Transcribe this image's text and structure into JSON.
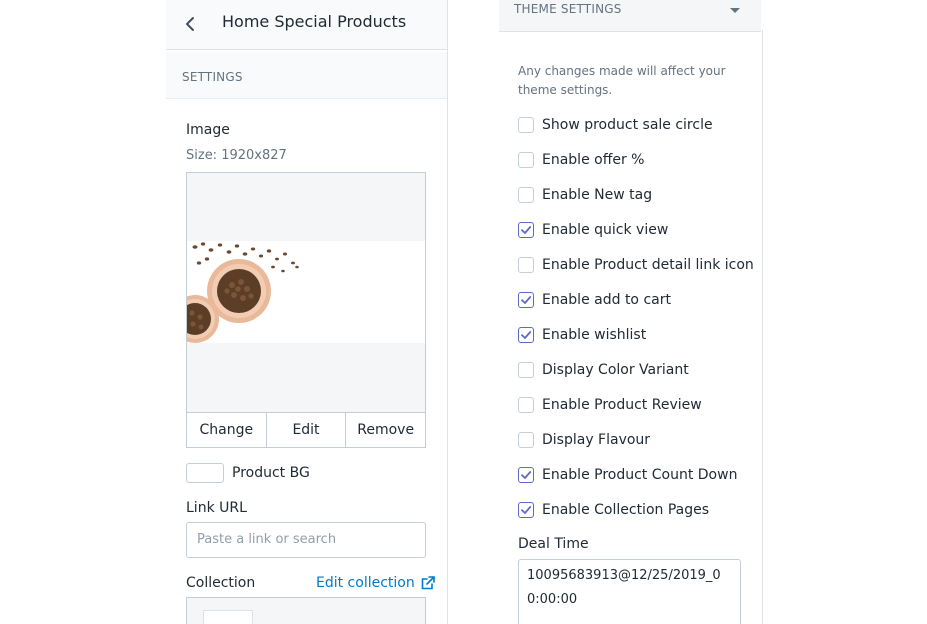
{
  "left_panel": {
    "title": "Home Special Products",
    "section_label": "SETTINGS",
    "image": {
      "label": "Image",
      "size_hint": "Size: 1920x827",
      "actions": [
        "Change",
        "Edit",
        "Remove"
      ]
    },
    "product_bg": {
      "label": "Product BG",
      "color": "#ffffff"
    },
    "link_url": {
      "label": "Link URL",
      "placeholder": "Paste a link or search"
    },
    "collection": {
      "label": "Collection",
      "edit_link": "Edit collection"
    }
  },
  "right_panel": {
    "header": "THEME SETTINGS",
    "note": "Any changes made will affect your theme settings.",
    "checkboxes": [
      {
        "label": "Show product sale circle",
        "checked": false
      },
      {
        "label": "Enable offer %",
        "checked": false
      },
      {
        "label": "Enable New tag",
        "checked": false
      },
      {
        "label": "Enable quick view",
        "checked": true
      },
      {
        "label": "Enable Product detail link icon",
        "checked": false
      },
      {
        "label": "Enable add to cart",
        "checked": true
      },
      {
        "label": "Enable wishlist",
        "checked": true
      },
      {
        "label": "Display Color Variant",
        "checked": false
      },
      {
        "label": "Enable Product Review",
        "checked": false
      },
      {
        "label": "Display Flavour",
        "checked": false
      },
      {
        "label": "Enable Product Count Down",
        "checked": true
      },
      {
        "label": "Enable Collection Pages",
        "checked": true
      }
    ],
    "deal_time": {
      "label": "Deal Time",
      "value": "10095683913@12/25/2019_00:00:00"
    }
  },
  "colors": {
    "accent": "#5c6ac4",
    "link": "#007ace",
    "border": "#c4cdd5",
    "muted_text": "#637381"
  }
}
